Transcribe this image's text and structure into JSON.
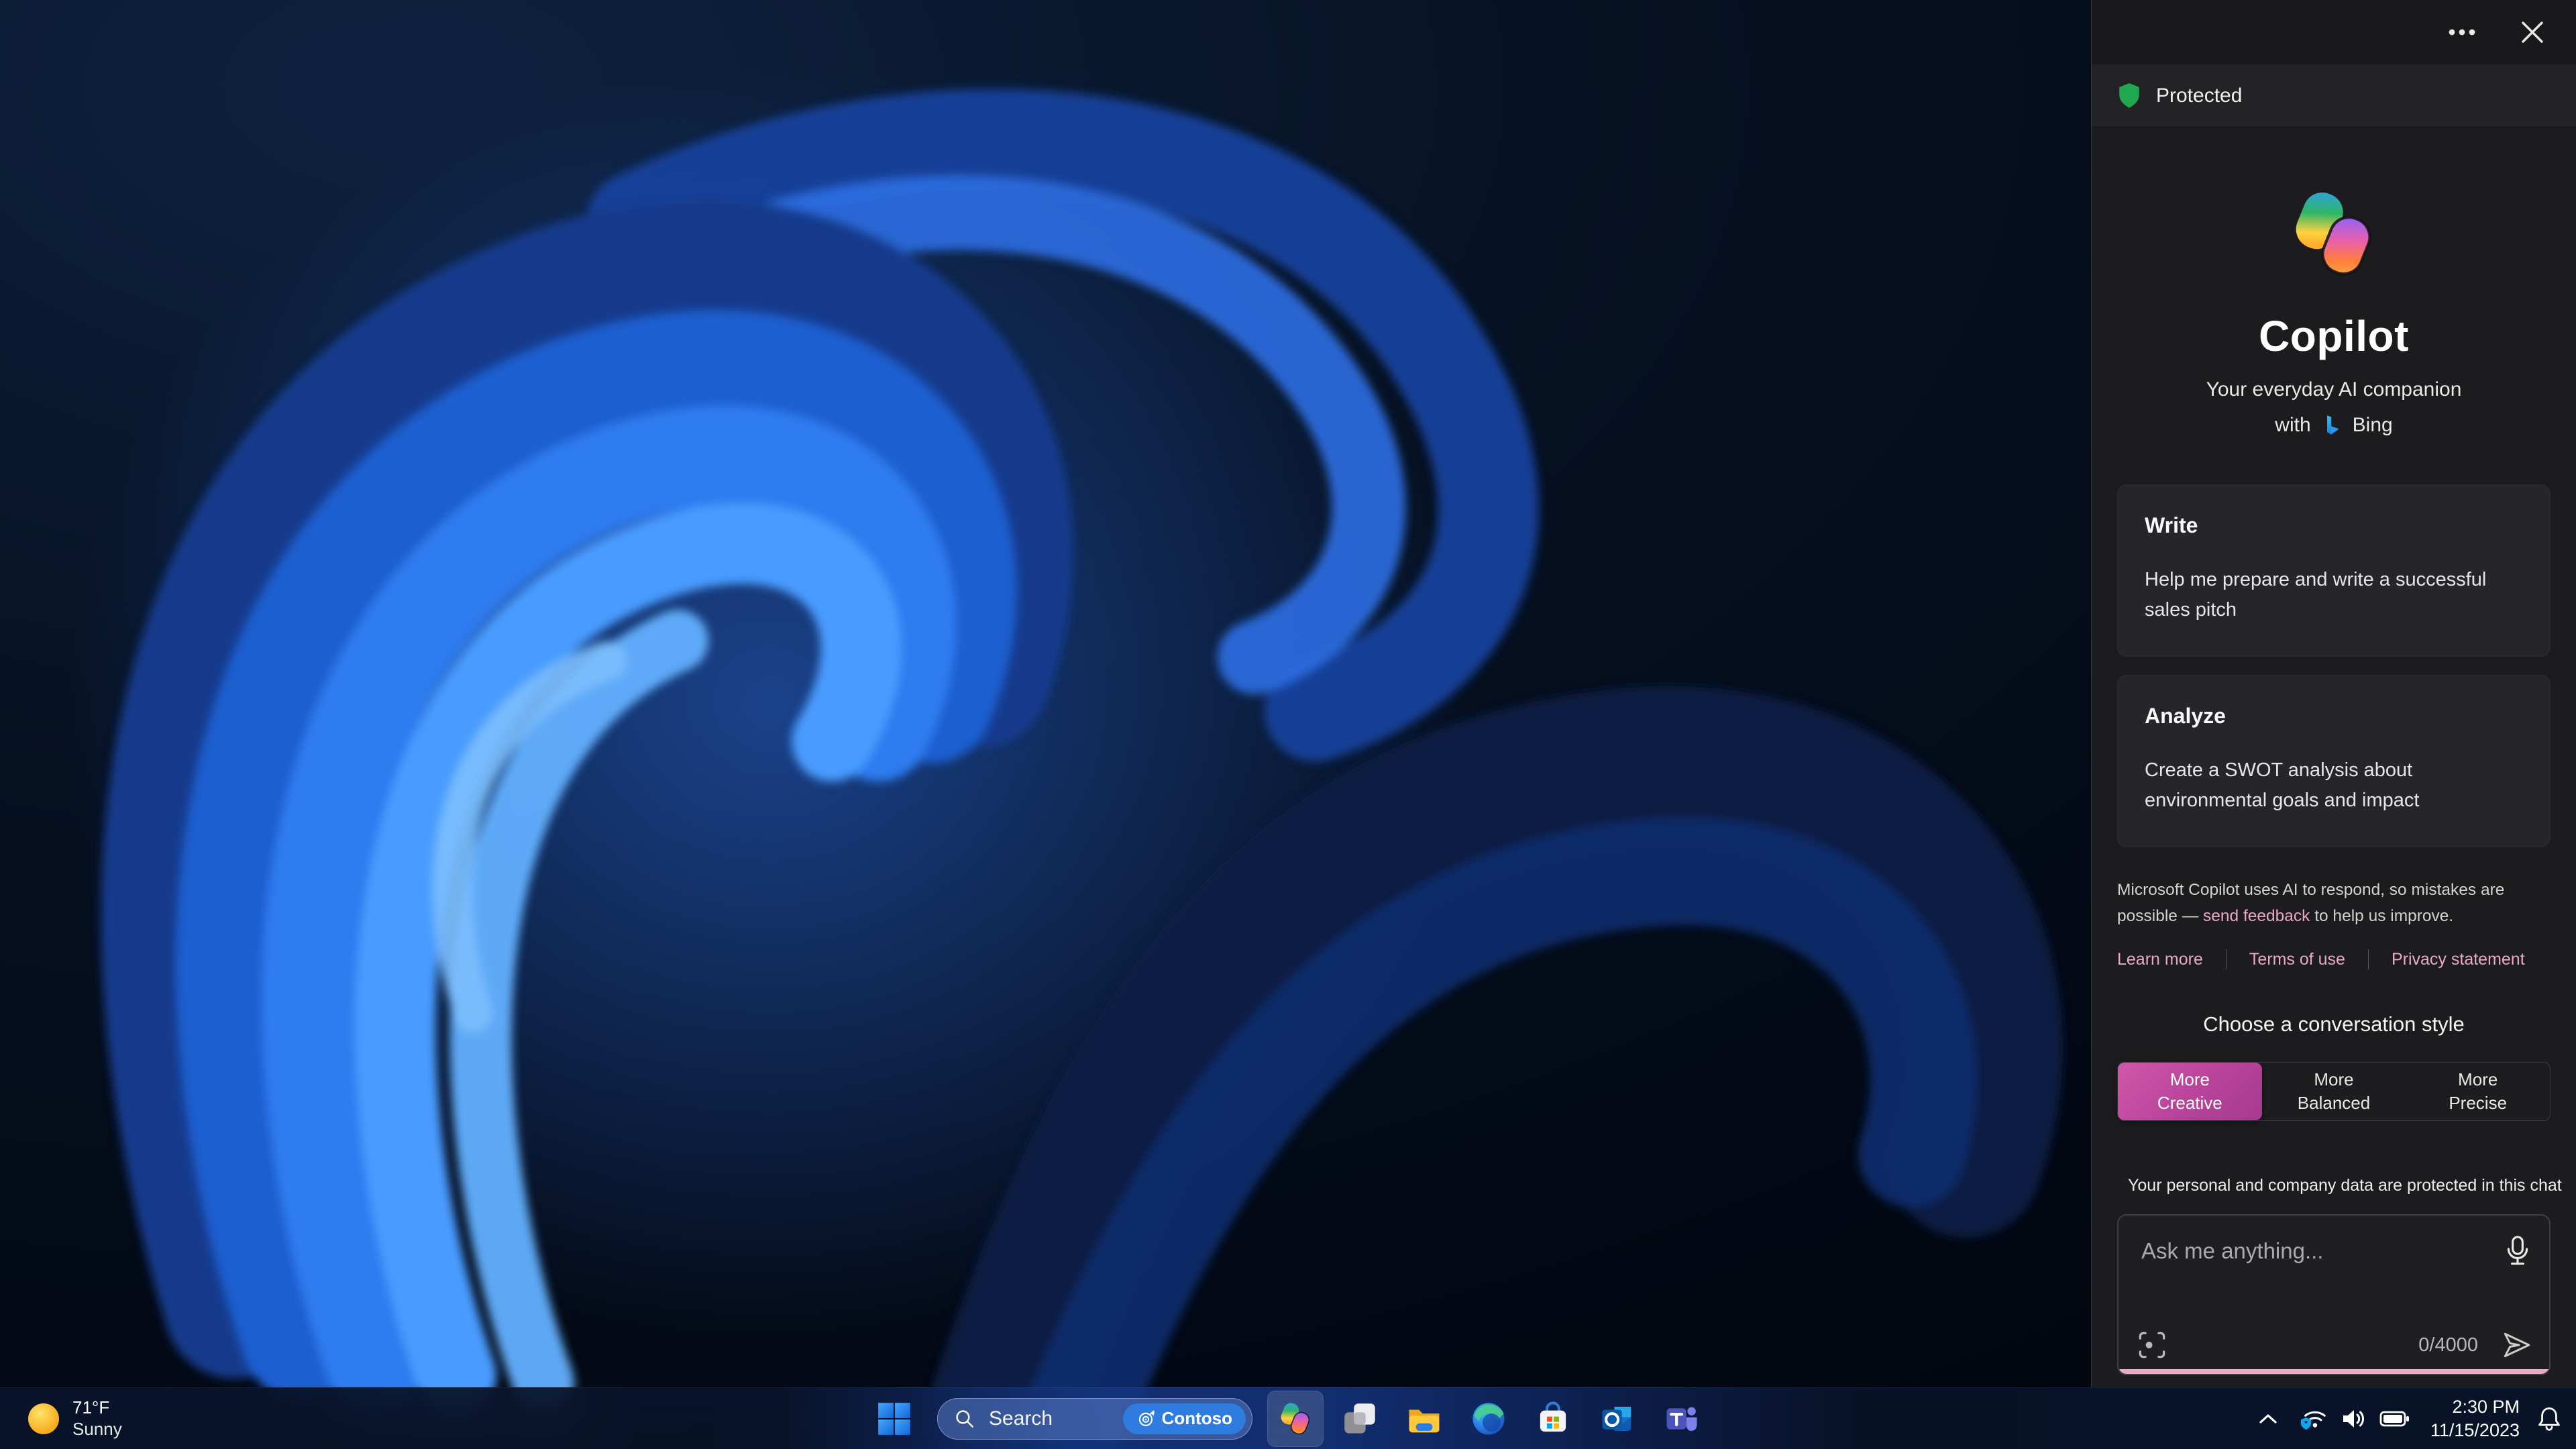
{
  "copilot_panel": {
    "protected_label": "Protected",
    "brand": {
      "title": "Copilot",
      "subtitle": "Your everyday AI companion",
      "with_label": "with",
      "bing_label": "Bing"
    },
    "cards": [
      {
        "title": "Write",
        "body": "Help me prepare and write a successful sales pitch"
      },
      {
        "title": "Analyze",
        "body": "Create a SWOT analysis about environmental goals and impact"
      }
    ],
    "disclaimer": {
      "part1": "Microsoft Copilot uses AI to respond, so mistakes are possible — ",
      "link": "send feedback",
      "part2": " to help us improve."
    },
    "links": {
      "learn_more": "Learn more",
      "terms": "Terms of use",
      "privacy": "Privacy statement"
    },
    "style_chooser": {
      "heading": "Choose a conversation style",
      "options": [
        {
          "line1": "More",
          "line2": "Creative",
          "selected": true
        },
        {
          "line1": "More",
          "line2": "Balanced",
          "selected": false
        },
        {
          "line1": "More",
          "line2": "Precise",
          "selected": false
        }
      ]
    },
    "privacy_note": "Your personal and company data are protected in this chat",
    "input": {
      "placeholder": "Ask me anything...",
      "counter": "0/4000"
    },
    "colors": {
      "panel_bg": "#1c1c1e",
      "card_bg": "#26262a",
      "accent_pink": "#eba7c6",
      "selected_style_gradient": [
        "#d058a8",
        "#a53a90"
      ],
      "protected_green": "#1fa84f"
    },
    "icons": {
      "header": [
        "more-options-icon",
        "close-icon"
      ],
      "protected": "shield-icon",
      "brand": [
        "copilot-logo",
        "bing-icon"
      ],
      "input": [
        "mic-icon",
        "screenshot-icon",
        "send-icon"
      ],
      "privacy": "shield-outline-icon"
    }
  },
  "taskbar": {
    "weather": {
      "temperature": "71°F",
      "condition": "Sunny"
    },
    "search": {
      "label": "Search",
      "badge": "Contoso"
    },
    "icons": [
      "sun-icon",
      "windows-start-icon",
      "search-icon",
      "target-icon",
      "copilot-icon",
      "task-view-icon",
      "folder-icon",
      "edge-icon",
      "store-icon",
      "outlook-icon",
      "teams-icon",
      "chevron-up-icon",
      "wifi-shield-icon",
      "speaker-icon",
      "battery-icon",
      "bell-icon"
    ],
    "tray": {
      "time": "2:30 PM",
      "date": "11/15/2023"
    }
  }
}
